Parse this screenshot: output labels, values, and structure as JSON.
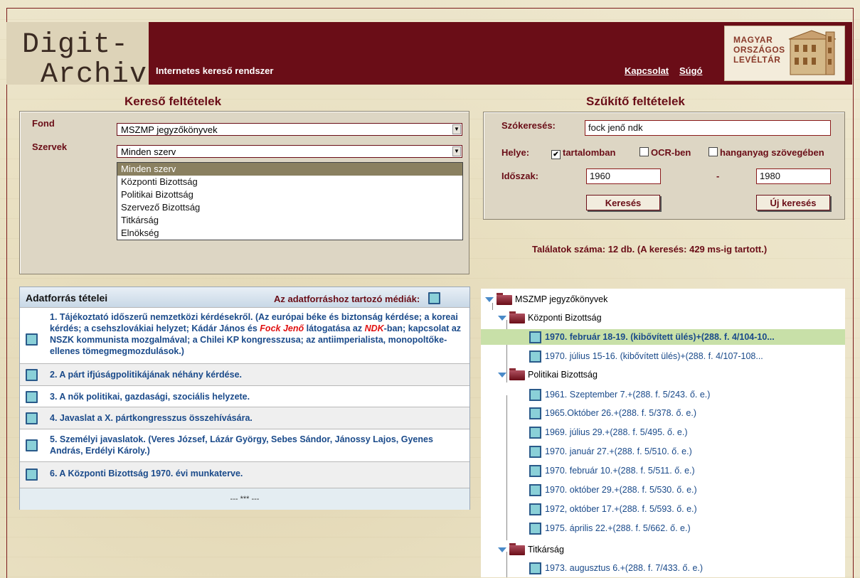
{
  "header": {
    "logo_line1": "Digit-",
    "logo_line2": "Archiv",
    "tagline": "Internetes kereső rendszer",
    "link_contact": "Kapcsolat",
    "link_help": "Súgó",
    "mol_line1": "MAGYAR",
    "mol_line2": "ORSZÁGOS",
    "mol_line3": "LEVÉLTÁR"
  },
  "search": {
    "title": "Kereső feltételek",
    "fond_label": "Fond",
    "fond_value": "MSZMP jegyzőkönyvek",
    "szervek_label": "Szervek",
    "szervek_value": "Minden szerv",
    "szervek_options": [
      "Minden szerv",
      "Központi Bizottság",
      "Politikai Bizottság",
      "Szervező Bizottság",
      "Titkárság",
      "Elnökség"
    ]
  },
  "filter": {
    "title": "Szűkítő feltételek",
    "keyword_label": "Szókeresés:",
    "keyword_value": "fock jenő ndk",
    "place_label": "Helye:",
    "opt_content": "tartalomban",
    "opt_ocr": "OCR-ben",
    "opt_audio": "hanganyag szövegében",
    "period_label": "Időszak:",
    "from": "1960",
    "dash": "-",
    "to": "1980",
    "search_button": "Keresés",
    "new_search_button": "Új keresés"
  },
  "result_count": "Találatok száma: 12 db. (A keresés: 429 ms-ig tartott.)",
  "sources": {
    "title": "Adatforrás tételei",
    "media_label": "Az adatforráshoz tartozó médiák:",
    "item1_a": "1. Tájékoztató időszerű nemzetközi kérdésekről. (Az európai béke és biztonság kérdése; a koreai kérdés; a csehszlovákiai helyzet; Kádár János és ",
    "item1_red1": "Fock Jenő",
    "item1_b": " látogatása az ",
    "item1_red2": "NDK",
    "item1_c": "-ban; kapcsolat az NSZK kommunista mozgalmával; a Chilei KP kongresszusa; az antiimperialista, monopoltőke-ellenes tömegmegmozdulások.)",
    "item2": "2. A párt ifjúságpolitikájának néhány kérdése.",
    "item3": "3. A nők politikai, gazdasági, szociális helyzete.",
    "item4": "4. Javaslat a X. pártkongresszus összehívására.",
    "item5": "5. Személyi javaslatok. (Veres József, Lázár György, Sebes Sándor, Jánossy Lajos, Gyenes András, Erdélyi Károly.)",
    "item6": "6. A Központi Bizottság 1970. évi munkaterve.",
    "footer": "--- *** ---"
  },
  "tree": {
    "root": "MSZMP jegyzőkönyvek",
    "kb": "Központi Bizottság",
    "kb_items": [
      "1970. február 18-19. (kibővített ülés)+(288. f. 4/104-10...",
      "1970. július 15-16. (kibővített ülés)+(288. f. 4/107-108..."
    ],
    "pb": "Politikai Bizottság",
    "pb_items": [
      "1961. Szeptember 7.+(288. f. 5/243. ő. e.)",
      "1965.Október 26.+(288. f. 5/378. ő. e.)",
      "1969. július 29.+(288. f. 5/495. ő. e.)",
      "1970. január 27.+(288. f. 5/510. ő. e.)",
      "1970. február 10.+(288. f. 5/511. ő. e.)",
      "1970. október 29.+(288. f. 5/530. ő. e.)",
      "1972, október 17.+(288. f. 5/593. ő. e.)",
      "1975. április 22.+(288. f. 5/662. ő. e.)"
    ],
    "tit": "Titkárság",
    "tit_items": [
      "1973. augusztus 6.+(288. f. 7/433. ő. e.)"
    ]
  }
}
